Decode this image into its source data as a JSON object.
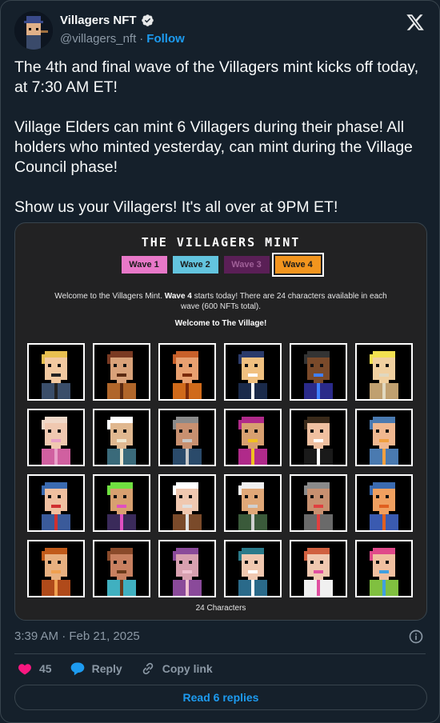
{
  "author": {
    "display_name": "Villagers NFT",
    "handle": "@villagers_nft",
    "separator": "·",
    "follow_label": "Follow"
  },
  "tweet": {
    "text": "The 4th and final wave of the Villagers mint kicks off today, at 7:30 AM ET!\n\nVillage Elders can mint 6 Villagers during their phase! All holders who minted yesterday, can mint during the Village Council phase!\n\nShow us your Villagers! It's all over at 9PM ET!",
    "timestamp": "3:39 AM · Feb 21, 2025"
  },
  "media": {
    "title": "THE VILLAGERS MINT",
    "waves": [
      {
        "label": "Wave 1",
        "color": "#e878c8"
      },
      {
        "label": "Wave 2",
        "color": "#63c4de"
      },
      {
        "label": "Wave 3",
        "color": "#5a1f56"
      },
      {
        "label": "Wave 4",
        "color": "#f2951e"
      }
    ],
    "intro_prefix": "Welcome to the Villagers Mint. ",
    "intro_bold": "Wave 4",
    "intro_suffix": " starts today! There are 24 characters available in each wave (600 NFTs total).",
    "welcome": "Welcome to The Village!",
    "character_count": "24 Characters",
    "characters": [
      {
        "skin": "#f2c9a0",
        "hair": "#e8c050",
        "shirt": "#3a4e6a",
        "accent": "#222"
      },
      {
        "skin": "#d9a27a",
        "hair": "#7a3a22",
        "shirt": "#b0662a",
        "accent": "#5a2a12"
      },
      {
        "skin": "#e8a070",
        "hair": "#c8602a",
        "shirt": "#d06a1a",
        "accent": "#7a2a0a"
      },
      {
        "skin": "#f0c080",
        "hair": "#2a3a6a",
        "shirt": "#1a2a4a",
        "accent": "#fff"
      },
      {
        "skin": "#7a4a2a",
        "hair": "#333",
        "shirt": "#2a2a8a",
        "accent": "#4080ff"
      },
      {
        "skin": "#f0d0a0",
        "hair": "#f2e050",
        "shirt": "#c0a070",
        "accent": "#e0d8c0"
      },
      {
        "skin": "#f0c8b0",
        "hair": "#f0d8c8",
        "shirt": "#d060a0",
        "accent": "#e8a0c8"
      },
      {
        "skin": "#e0b890",
        "hair": "#ffffff",
        "shirt": "#3a6a7a",
        "accent": "#f0e8d0"
      },
      {
        "skin": "#c89070",
        "hair": "#8a8a8a",
        "shirt": "#2a4a6a",
        "accent": "#c8c8c8"
      },
      {
        "skin": "#d8a070",
        "hair": "#b02a8a",
        "shirt": "#b02a8a",
        "accent": "#f0c020"
      },
      {
        "skin": "#f0c0a0",
        "hair": "#3a2a1a",
        "shirt": "#1a1a1a",
        "accent": "#fff"
      },
      {
        "skin": "#f0b890",
        "hair": "#4a7ab0",
        "shirt": "#4a7ab0",
        "accent": "#f0a040"
      },
      {
        "skin": "#f0c0a0",
        "hair": "#3a6ab0",
        "shirt": "#3a5a9a",
        "accent": "#d03030"
      },
      {
        "skin": "#d8a070",
        "hair": "#70e040",
        "shirt": "#3a2a5a",
        "accent": "#e050c0"
      },
      {
        "skin": "#f0c8b0",
        "hair": "#ffffff",
        "shirt": "#7a4a2a",
        "accent": "#e0e0e0"
      },
      {
        "skin": "#e0a878",
        "hair": "#f0f0f0",
        "shirt": "#3a5a3a",
        "accent": "#d0d0d0"
      },
      {
        "skin": "#c89070",
        "hair": "#8a8a8a",
        "shirt": "#6a6a6a",
        "accent": "#e04040"
      },
      {
        "skin": "#f0a060",
        "hair": "#3a6ab0",
        "shirt": "#3a5ab0",
        "accent": "#e06020"
      },
      {
        "skin": "#e8b080",
        "hair": "#c05a1a",
        "shirt": "#b04a1a",
        "accent": "#f0a050"
      },
      {
        "skin": "#c88060",
        "hair": "#8a4a2a",
        "shirt": "#40b0c0",
        "accent": "#6a3a1a"
      },
      {
        "skin": "#d8a0b0",
        "hair": "#8a4a9a",
        "shirt": "#8a4a9a",
        "accent": "#f0c0d0"
      },
      {
        "skin": "#f0c8b0",
        "hair": "#2a7a8a",
        "shirt": "#2a6a8a",
        "accent": "#ffffff"
      },
      {
        "skin": "#f0c8b0",
        "hair": "#d06040",
        "shirt": "#f0f0f0",
        "accent": "#e050a0"
      },
      {
        "skin": "#f0c0a0",
        "hair": "#e04a8a",
        "shirt": "#80c040",
        "accent": "#40a0e0"
      }
    ]
  },
  "actions": {
    "like_count": "45",
    "reply_label": "Reply",
    "copy_link_label": "Copy link"
  },
  "read_replies_label": "Read 6 replies"
}
